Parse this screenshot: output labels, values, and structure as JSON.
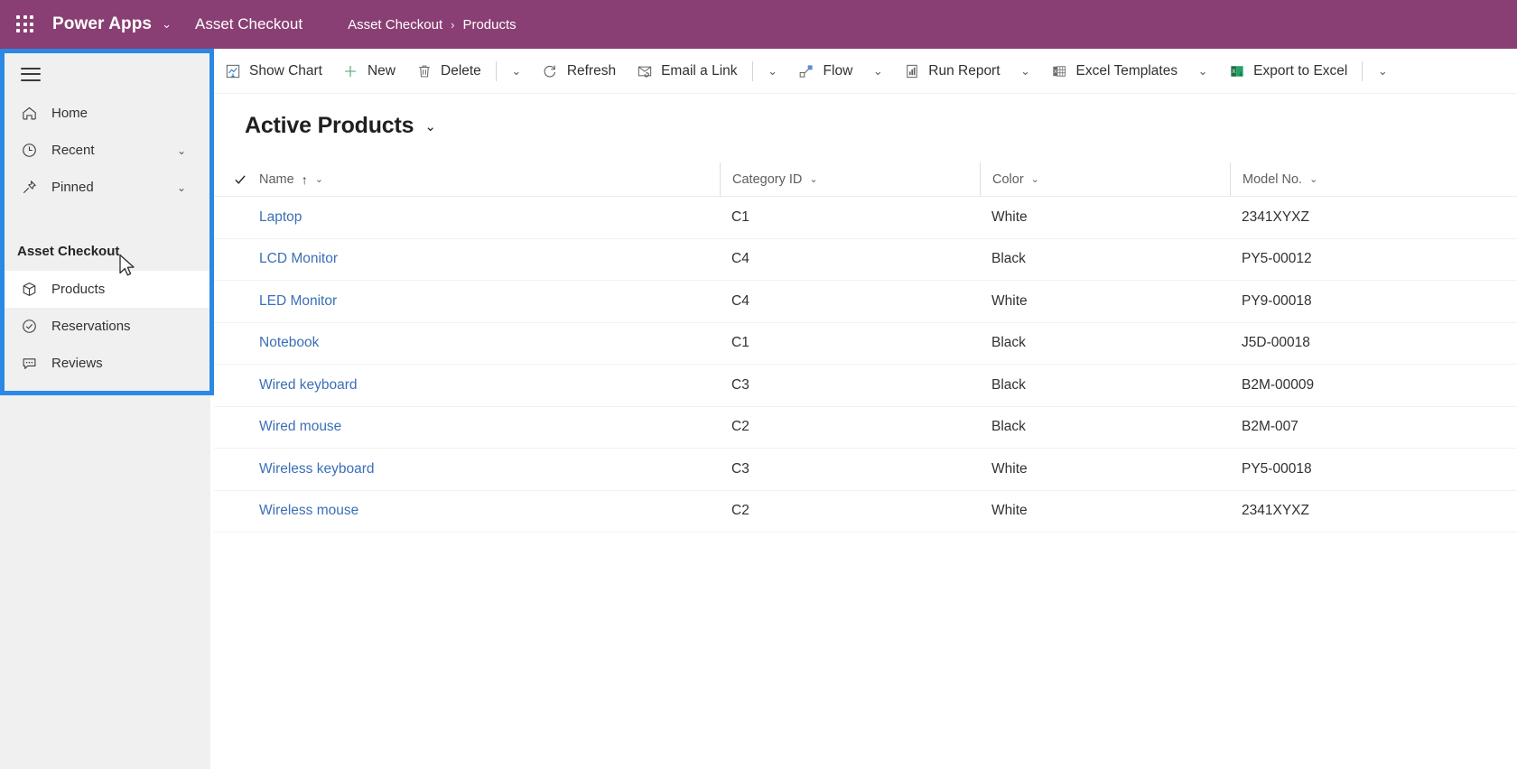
{
  "header": {
    "waffle_icon": "app-launcher-icon",
    "brand": "Power Apps",
    "brand_chevron": "⌄",
    "app_name": "Asset Checkout",
    "breadcrumb": {
      "root": "Asset Checkout",
      "separator": "›",
      "current": "Products"
    },
    "accent_color": "#893f73"
  },
  "sidebar": {
    "toggle_icon": "hamburger-icon",
    "focus_ring_color": "#2b88e4",
    "background": "#f0f0f0",
    "items": [
      {
        "label": "Home",
        "icon": "home-icon",
        "chevron": "",
        "selected": false
      },
      {
        "label": "Recent",
        "icon": "clock-icon",
        "chevron": "⌄",
        "selected": false
      },
      {
        "label": "Pinned",
        "icon": "pin-icon",
        "chevron": "⌄",
        "selected": false
      }
    ],
    "group_label": "Asset Checkout",
    "group_items": [
      {
        "label": "Products",
        "icon": "box-icon",
        "selected": true
      },
      {
        "label": "Reservations",
        "icon": "check-circle-icon",
        "selected": false
      },
      {
        "label": "Reviews",
        "icon": "comment-icon",
        "selected": false
      }
    ]
  },
  "command_bar": {
    "buttons": [
      {
        "label": "Show Chart",
        "icon": "chart-icon"
      },
      {
        "label": "New",
        "icon": "plus-icon"
      },
      {
        "label": "Delete",
        "icon": "trash-icon"
      },
      {
        "label": "Refresh",
        "icon": "refresh-icon"
      },
      {
        "label": "Email a Link",
        "icon": "email-link-icon"
      },
      {
        "label": "Flow",
        "icon": "flow-icon"
      },
      {
        "label": "Run Report",
        "icon": "report-icon"
      },
      {
        "label": "Excel Templates",
        "icon": "excel-template-icon"
      },
      {
        "label": "Export to Excel",
        "icon": "excel-export-icon"
      }
    ],
    "overflow_chevron": "⌄"
  },
  "view": {
    "name": "Active Products",
    "chevron": "⌄"
  },
  "grid": {
    "select_all_icon": "checkmark-icon",
    "columns": [
      {
        "label": "Name",
        "sort": "↑",
        "chevron": "⌄"
      },
      {
        "label": "Category ID",
        "sort": "",
        "chevron": "⌄"
      },
      {
        "label": "Color",
        "sort": "",
        "chevron": "⌄"
      },
      {
        "label": "Model No.",
        "sort": "",
        "chevron": "⌄"
      }
    ],
    "rows": [
      {
        "name": "Laptop",
        "category": "C1",
        "color": "White",
        "model": "2341XYXZ"
      },
      {
        "name": "LCD Monitor",
        "category": "C4",
        "color": "Black",
        "model": "PY5-00012"
      },
      {
        "name": "LED Monitor",
        "category": "C4",
        "color": "White",
        "model": "PY9-00018"
      },
      {
        "name": "Notebook",
        "category": "C1",
        "color": "Black",
        "model": "J5D-00018"
      },
      {
        "name": "Wired keyboard",
        "category": "C3",
        "color": "Black",
        "model": "B2M-00009"
      },
      {
        "name": "Wired mouse",
        "category": "C2",
        "color": "Black",
        "model": "B2M-007"
      },
      {
        "name": "Wireless keyboard",
        "category": "C3",
        "color": "White",
        "model": "PY5-00018"
      },
      {
        "name": "Wireless mouse",
        "category": "C2",
        "color": "White",
        "model": "2341XYXZ"
      }
    ],
    "link_color": "#3b6fb6"
  }
}
